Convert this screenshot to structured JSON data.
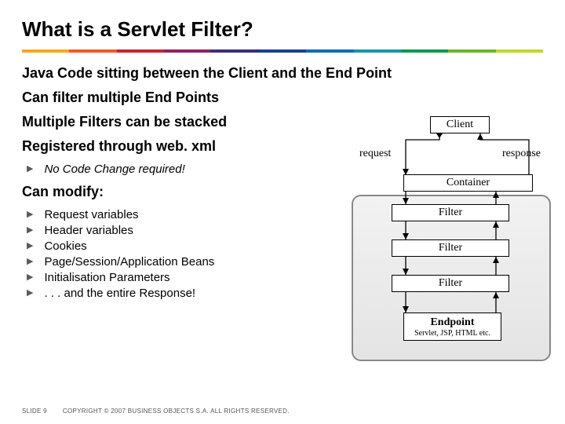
{
  "title": "What is a Servlet Filter?",
  "rainbow_colors": [
    "#f7a81b",
    "#f05a28",
    "#c2272d",
    "#8e1f63",
    "#3b2e7e",
    "#1b3f94",
    "#0b6db7",
    "#0a9aa8",
    "#0a9a4b",
    "#6bb52b",
    "#c0d72f"
  ],
  "points": {
    "p1": "Java Code sitting between the Client and the End Point",
    "p2": "Can filter multiple End Points",
    "p3": "Multiple Filters can be stacked",
    "p4": "Registered through web. xml",
    "p4_sub": "No Code Change required!",
    "p5": "Can modify:",
    "modify_items": [
      "Request variables",
      "Header variables",
      "Cookies",
      "Page/Session/Application Beans",
      "Initialisation Parameters",
      ". . . and the entire Response!"
    ]
  },
  "diagram": {
    "client": "Client",
    "request": "request",
    "response": "response",
    "container": "Container",
    "filter": "Filter",
    "endpoint_title": "Endpoint",
    "endpoint_sub": "Servlet, JSP, HTML etc."
  },
  "footer": {
    "slide_no": "SLIDE 9",
    "copyright": "COPYRIGHT © 2007 BUSINESS OBJECTS S.A. ALL RIGHTS RESERVED."
  }
}
